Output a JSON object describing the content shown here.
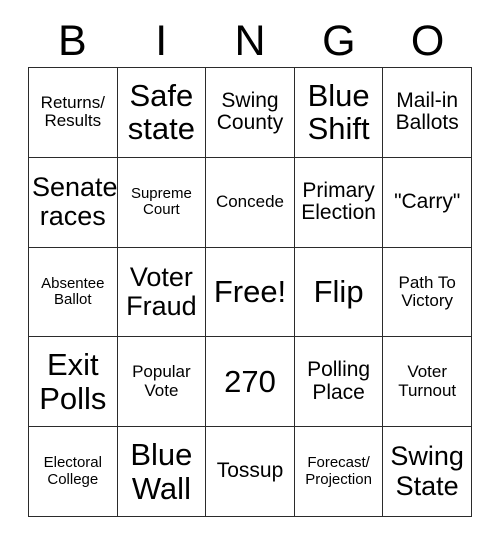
{
  "card": {
    "header_letters": [
      "B",
      "I",
      "N",
      "G",
      "O"
    ],
    "grid": {
      "rows": 5,
      "columns": 5,
      "border_color": "#2b2b2b",
      "background_color": "#ffffff",
      "text_color": "#000000"
    },
    "cells": [
      {
        "text": "Returns/\nResults",
        "size": "fs-sm"
      },
      {
        "text": "Safe\nstate",
        "size": "fs-xl"
      },
      {
        "text": "Swing\nCounty",
        "size": "fs-md"
      },
      {
        "text": "Blue\nShift",
        "size": "fs-xl"
      },
      {
        "text": "Mail-in\nBallots",
        "size": "fs-md"
      },
      {
        "text": "Senate\nraces",
        "size": "fs-lg"
      },
      {
        "text": "Supreme\nCourt",
        "size": "fs-xs"
      },
      {
        "text": "Concede",
        "size": "fs-sm"
      },
      {
        "text": "Primary\nElection",
        "size": "fs-md"
      },
      {
        "text": "\"Carry\"",
        "size": "fs-md"
      },
      {
        "text": "Absentee\nBallot",
        "size": "fs-xs"
      },
      {
        "text": "Voter\nFraud",
        "size": "fs-lg"
      },
      {
        "text": "Free!",
        "size": "fs-xl"
      },
      {
        "text": "Flip",
        "size": "fs-xl"
      },
      {
        "text": "Path To\nVictory",
        "size": "fs-sm"
      },
      {
        "text": "Exit\nPolls",
        "size": "fs-xl"
      },
      {
        "text": "Popular\nVote",
        "size": "fs-sm"
      },
      {
        "text": "270",
        "size": "fs-xl"
      },
      {
        "text": "Polling\nPlace",
        "size": "fs-md"
      },
      {
        "text": "Voter\nTurnout",
        "size": "fs-sm"
      },
      {
        "text": "Electoral\nCollege",
        "size": "fs-xs"
      },
      {
        "text": "Blue\nWall",
        "size": "fs-xl"
      },
      {
        "text": "Tossup",
        "size": "fs-md"
      },
      {
        "text": "Forecast/\nProjection",
        "size": "fs-xs"
      },
      {
        "text": "Swing\nState",
        "size": "fs-lg"
      }
    ]
  }
}
